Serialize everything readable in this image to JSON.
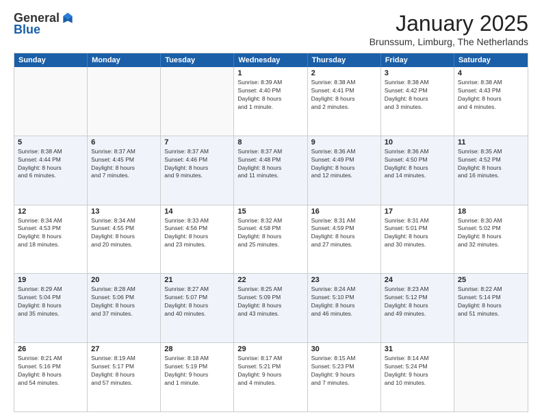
{
  "logo": {
    "general": "General",
    "blue": "Blue"
  },
  "title": "January 2025",
  "location": "Brunssum, Limburg, The Netherlands",
  "days_of_week": [
    "Sunday",
    "Monday",
    "Tuesday",
    "Wednesday",
    "Thursday",
    "Friday",
    "Saturday"
  ],
  "weeks": [
    [
      {
        "day": "",
        "info": ""
      },
      {
        "day": "",
        "info": ""
      },
      {
        "day": "",
        "info": ""
      },
      {
        "day": "1",
        "info": "Sunrise: 8:39 AM\nSunset: 4:40 PM\nDaylight: 8 hours\nand 1 minute."
      },
      {
        "day": "2",
        "info": "Sunrise: 8:38 AM\nSunset: 4:41 PM\nDaylight: 8 hours\nand 2 minutes."
      },
      {
        "day": "3",
        "info": "Sunrise: 8:38 AM\nSunset: 4:42 PM\nDaylight: 8 hours\nand 3 minutes."
      },
      {
        "day": "4",
        "info": "Sunrise: 8:38 AM\nSunset: 4:43 PM\nDaylight: 8 hours\nand 4 minutes."
      }
    ],
    [
      {
        "day": "5",
        "info": "Sunrise: 8:38 AM\nSunset: 4:44 PM\nDaylight: 8 hours\nand 6 minutes."
      },
      {
        "day": "6",
        "info": "Sunrise: 8:37 AM\nSunset: 4:45 PM\nDaylight: 8 hours\nand 7 minutes."
      },
      {
        "day": "7",
        "info": "Sunrise: 8:37 AM\nSunset: 4:46 PM\nDaylight: 8 hours\nand 9 minutes."
      },
      {
        "day": "8",
        "info": "Sunrise: 8:37 AM\nSunset: 4:48 PM\nDaylight: 8 hours\nand 11 minutes."
      },
      {
        "day": "9",
        "info": "Sunrise: 8:36 AM\nSunset: 4:49 PM\nDaylight: 8 hours\nand 12 minutes."
      },
      {
        "day": "10",
        "info": "Sunrise: 8:36 AM\nSunset: 4:50 PM\nDaylight: 8 hours\nand 14 minutes."
      },
      {
        "day": "11",
        "info": "Sunrise: 8:35 AM\nSunset: 4:52 PM\nDaylight: 8 hours\nand 16 minutes."
      }
    ],
    [
      {
        "day": "12",
        "info": "Sunrise: 8:34 AM\nSunset: 4:53 PM\nDaylight: 8 hours\nand 18 minutes."
      },
      {
        "day": "13",
        "info": "Sunrise: 8:34 AM\nSunset: 4:55 PM\nDaylight: 8 hours\nand 20 minutes."
      },
      {
        "day": "14",
        "info": "Sunrise: 8:33 AM\nSunset: 4:56 PM\nDaylight: 8 hours\nand 23 minutes."
      },
      {
        "day": "15",
        "info": "Sunrise: 8:32 AM\nSunset: 4:58 PM\nDaylight: 8 hours\nand 25 minutes."
      },
      {
        "day": "16",
        "info": "Sunrise: 8:31 AM\nSunset: 4:59 PM\nDaylight: 8 hours\nand 27 minutes."
      },
      {
        "day": "17",
        "info": "Sunrise: 8:31 AM\nSunset: 5:01 PM\nDaylight: 8 hours\nand 30 minutes."
      },
      {
        "day": "18",
        "info": "Sunrise: 8:30 AM\nSunset: 5:02 PM\nDaylight: 8 hours\nand 32 minutes."
      }
    ],
    [
      {
        "day": "19",
        "info": "Sunrise: 8:29 AM\nSunset: 5:04 PM\nDaylight: 8 hours\nand 35 minutes."
      },
      {
        "day": "20",
        "info": "Sunrise: 8:28 AM\nSunset: 5:06 PM\nDaylight: 8 hours\nand 37 minutes."
      },
      {
        "day": "21",
        "info": "Sunrise: 8:27 AM\nSunset: 5:07 PM\nDaylight: 8 hours\nand 40 minutes."
      },
      {
        "day": "22",
        "info": "Sunrise: 8:25 AM\nSunset: 5:09 PM\nDaylight: 8 hours\nand 43 minutes."
      },
      {
        "day": "23",
        "info": "Sunrise: 8:24 AM\nSunset: 5:10 PM\nDaylight: 8 hours\nand 46 minutes."
      },
      {
        "day": "24",
        "info": "Sunrise: 8:23 AM\nSunset: 5:12 PM\nDaylight: 8 hours\nand 49 minutes."
      },
      {
        "day": "25",
        "info": "Sunrise: 8:22 AM\nSunset: 5:14 PM\nDaylight: 8 hours\nand 51 minutes."
      }
    ],
    [
      {
        "day": "26",
        "info": "Sunrise: 8:21 AM\nSunset: 5:16 PM\nDaylight: 8 hours\nand 54 minutes."
      },
      {
        "day": "27",
        "info": "Sunrise: 8:19 AM\nSunset: 5:17 PM\nDaylight: 8 hours\nand 57 minutes."
      },
      {
        "day": "28",
        "info": "Sunrise: 8:18 AM\nSunset: 5:19 PM\nDaylight: 9 hours\nand 1 minute."
      },
      {
        "day": "29",
        "info": "Sunrise: 8:17 AM\nSunset: 5:21 PM\nDaylight: 9 hours\nand 4 minutes."
      },
      {
        "day": "30",
        "info": "Sunrise: 8:15 AM\nSunset: 5:23 PM\nDaylight: 9 hours\nand 7 minutes."
      },
      {
        "day": "31",
        "info": "Sunrise: 8:14 AM\nSunset: 5:24 PM\nDaylight: 9 hours\nand 10 minutes."
      },
      {
        "day": "",
        "info": ""
      }
    ]
  ]
}
